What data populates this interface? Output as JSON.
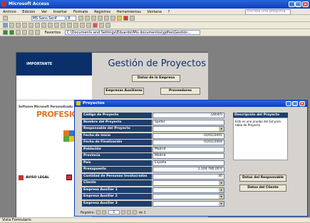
{
  "app": {
    "title": "Microsoft Access"
  },
  "menu": [
    "Archivo",
    "Edición",
    "Ver",
    "Insertar",
    "Formato",
    "Registros",
    "Herramientas",
    "Ventana",
    "?"
  ],
  "help_box": "Escriba una pregunta",
  "toolbar": {
    "font": "MS Sans Serif",
    "size": "8",
    "address": "C:\\Documents and Settings\\Eduardo\\Mis documentos\\gdfes\\Gestión...",
    "favorites": "Favoritos"
  },
  "main_form": {
    "left_label": "IMPORTANTE",
    "title": "Gestión de Proyectos",
    "buttons": [
      "Datos de la Empresa",
      "Empresas Auxiliares",
      "Proveedores"
    ],
    "promo_line1": "Software Microsoft Personalizado",
    "promo_line2": "PROFESIONAL",
    "aviso": "AVISO LEGAL"
  },
  "proyectos": {
    "title": "Proyectos",
    "rows": [
      {
        "label": "Código de Proyecto",
        "value": "(28)4/5",
        "align": "right"
      },
      {
        "label": "Nombre del Proyecto",
        "value": "Spider",
        "align": "left"
      },
      {
        "label": "Responsable del Proyecto",
        "value": "",
        "align": "left",
        "dropdown": true
      },
      {
        "label": "Fecha de Inicio",
        "value": "01/01/2001",
        "align": "right"
      },
      {
        "label": "Fecha de Finalización",
        "value": "01/01/2004",
        "align": "right"
      },
      {
        "label": "Población",
        "value": "Madrid",
        "align": "left"
      },
      {
        "label": "Provincia",
        "value": "Madrid",
        "align": "left"
      },
      {
        "label": "País",
        "value": "España",
        "align": "left"
      },
      {
        "label": "Presupuesto",
        "value": "1.104.780,00 €",
        "align": "right"
      },
      {
        "label": "Cantidad de Personas Involucradas",
        "value": "40",
        "align": "right"
      },
      {
        "label": "Cliente",
        "value": "",
        "align": "left",
        "dropdown": true
      },
      {
        "label": "Empresa Auxiliar 1",
        "value": "",
        "align": "left",
        "dropdown": true
      },
      {
        "label": "Empresa Auxiliar 2",
        "value": "",
        "align": "left",
        "dropdown": true
      },
      {
        "label": "Empresa Auxiliar 3",
        "value": "",
        "align": "left",
        "dropdown": true
      }
    ],
    "desc_label": "Descripción del Proyecto",
    "desc_text": "Esto es una prueba del Est para tabla de Proyecto",
    "btn_responsable": "Datos del Responsable",
    "btn_cliente": "Datos del Cliente",
    "nav": {
      "label": "Registro:",
      "current": "1",
      "total": "de 1"
    }
  },
  "status": "Vista Formulario"
}
